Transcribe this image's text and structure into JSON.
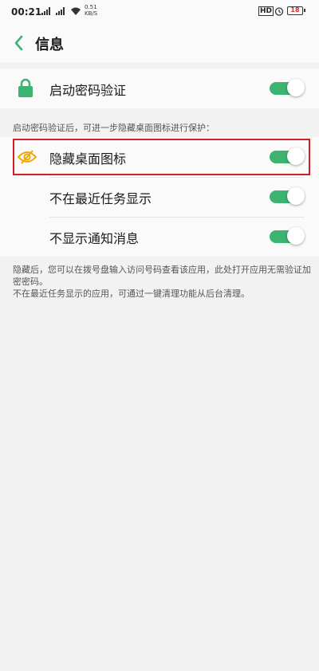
{
  "status_bar": {
    "time": "00:21",
    "net_speed_value": "0.51",
    "net_speed_unit": "KB/S",
    "hd_label": "HD",
    "battery_level": "18"
  },
  "header": {
    "title": "信息"
  },
  "password": {
    "label": "启动密码验证",
    "enabled": true
  },
  "section_hint": "启动密码验证后，可进一步隐藏桌面图标进行保护：",
  "options": [
    {
      "label": "隐藏桌面图标",
      "enabled": true
    },
    {
      "label": "不在最近任务显示",
      "enabled": true
    },
    {
      "label": "不显示通知消息",
      "enabled": true
    }
  ],
  "footer": {
    "line1": "隐藏后，您可以在拨号盘输入访问号码查看该应用，此处打开应用无需验证加密密码。",
    "line2": "不在最近任务显示的应用，可通过一键清理功能从后台清理。"
  },
  "colors": {
    "accent": "#3cb371",
    "highlight": "#d01f2a",
    "hide_icon": "#f0a800"
  }
}
